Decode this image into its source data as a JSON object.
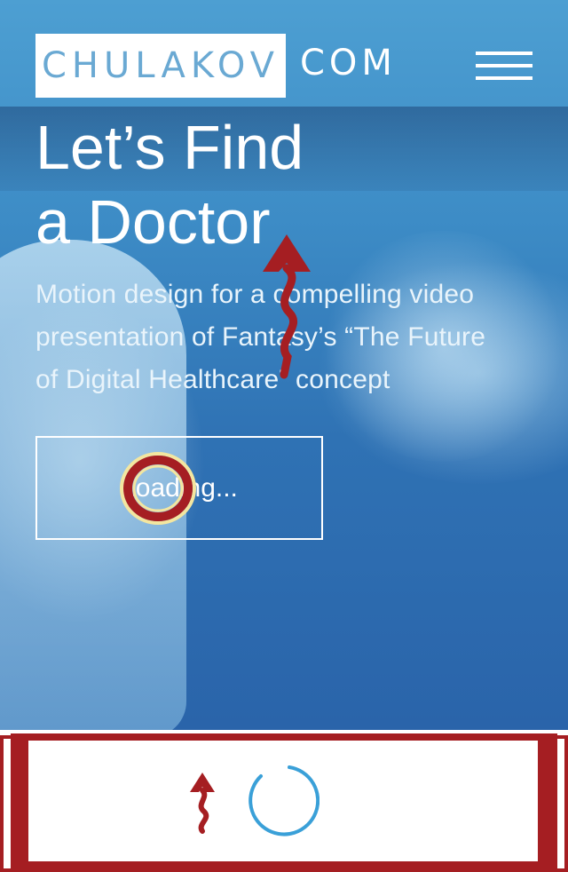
{
  "header": {
    "logo_text": "CHULAKOV",
    "logo_suffix": "COM",
    "menu_icon": "hamburger-menu-icon"
  },
  "hero": {
    "title_line1": "Let’s Find",
    "title_line2": "a Doctor",
    "subtitle_line1": "Motion design for a compelling video",
    "subtitle_line2": "presentation of Fantasy’s “The Future",
    "subtitle_line3": "of Digital Healthcare” concept",
    "button_label": "Loading..."
  },
  "footer": {
    "spinner_icon": "loading-spinner-icon"
  },
  "colors": {
    "hero_blue": "#3d8cc6",
    "logo_blue": "#6aa9d3",
    "spinner_blue": "#3aa0d8",
    "annotation_red": "#a51e22",
    "annotation_yellow": "#f3e6a0"
  }
}
